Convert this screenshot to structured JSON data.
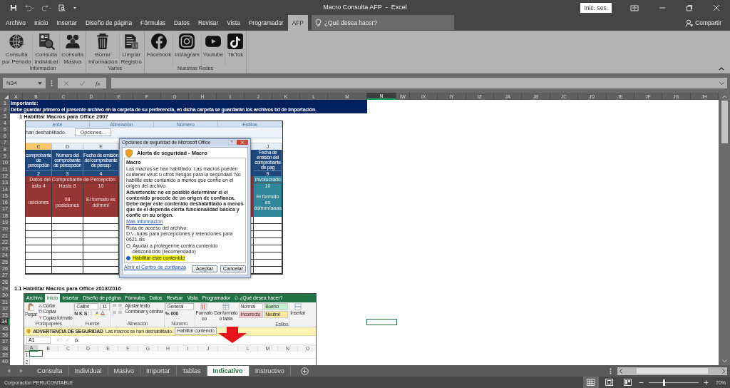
{
  "title_bar": {
    "title": "Macro Consulta AFP  -  Excel",
    "sign_in": "Inic. ses."
  },
  "menu_tabs": [
    {
      "label": "Archivo",
      "selected": false
    },
    {
      "label": "Inicio",
      "selected": false
    },
    {
      "label": "Insertar",
      "selected": false
    },
    {
      "label": "Diseño de página",
      "selected": false
    },
    {
      "label": "Fórmulas",
      "selected": false
    },
    {
      "label": "Datos",
      "selected": false
    },
    {
      "label": "Revisar",
      "selected": false
    },
    {
      "label": "Vista",
      "selected": false
    },
    {
      "label": "Programador",
      "selected": false
    },
    {
      "label": "AFP",
      "selected": true
    }
  ],
  "tell_me": {
    "placeholder": "¿Qué desea hacer?"
  },
  "share": "Compartir",
  "ribbon_groups": [
    {
      "label": "Informacion",
      "buttons": [
        {
          "kind": "globe",
          "lines": [
            "Consulta",
            "por Periodo"
          ]
        },
        {
          "kind": "search_doc",
          "lines": [
            "Consulta",
            "Individual"
          ]
        },
        {
          "kind": "people",
          "lines": [
            "Consulta",
            "Masiva"
          ]
        }
      ]
    },
    {
      "label": "Varios",
      "buttons": [
        {
          "kind": "trash",
          "lines": [
            "Borrar",
            "Información"
          ]
        },
        {
          "kind": "document",
          "lines": [
            "Limpiar",
            "Registro"
          ]
        }
      ]
    },
    {
      "label": "Nuestras Redes",
      "buttons": [
        {
          "kind": "facebook",
          "lines": [
            "Facebook"
          ]
        },
        {
          "kind": "instagram",
          "lines": [
            "Instagram"
          ]
        },
        {
          "kind": "youtube",
          "lines": [
            "Youtube"
          ]
        },
        {
          "kind": "tiktok",
          "lines": [
            "TikTok"
          ]
        }
      ]
    }
  ],
  "name_box": "N34",
  "fx": "fx",
  "columns": [
    {
      "label": "A",
      "selected": false
    },
    {
      "label": "B",
      "selected": false
    },
    {
      "label": "C",
      "selected": false
    },
    {
      "label": "D",
      "selected": false
    },
    {
      "label": "E",
      "selected": false
    },
    {
      "label": "F",
      "selected": false
    },
    {
      "label": "G",
      "selected": false
    },
    {
      "label": "H",
      "selected": false
    },
    {
      "label": "I",
      "selected": false
    },
    {
      "label": "J",
      "selected": false
    },
    {
      "label": "K",
      "selected": false
    },
    {
      "label": "L",
      "selected": false
    },
    {
      "label": "M",
      "selected": false
    },
    {
      "label": "N",
      "selected": true
    },
    {
      "label": "IW",
      "selected": false
    },
    {
      "label": "IX",
      "selected": false
    },
    {
      "label": "IY",
      "selected": false
    },
    {
      "label": "IZ",
      "selected": false
    },
    {
      "label": "JA",
      "selected": false
    },
    {
      "label": "JB",
      "selected": false
    },
    {
      "label": "JC",
      "selected": false
    },
    {
      "label": "JD",
      "selected": false
    },
    {
      "label": "JE",
      "selected": false
    },
    {
      "label": "JF",
      "selected": false
    },
    {
      "label": "JG",
      "selected": false
    },
    {
      "label": "JH",
      "selected": false
    }
  ],
  "rows": [
    {
      "label": "1",
      "selected": false
    },
    {
      "label": "2",
      "selected": false
    },
    {
      "label": "3",
      "selected": false
    },
    {
      "label": "4",
      "selected": false
    },
    {
      "label": "5",
      "selected": false
    },
    {
      "label": "6",
      "selected": false
    },
    {
      "label": "7",
      "selected": false
    },
    {
      "label": "8",
      "selected": false
    },
    {
      "label": "9",
      "selected": false
    },
    {
      "label": "10",
      "selected": false
    },
    {
      "label": "11",
      "selected": false
    },
    {
      "label": "12",
      "selected": false
    },
    {
      "label": "13",
      "selected": false
    },
    {
      "label": "14",
      "selected": false
    },
    {
      "label": "15",
      "selected": false
    },
    {
      "label": "16",
      "selected": false
    },
    {
      "label": "17",
      "selected": false
    },
    {
      "label": "18",
      "selected": false
    },
    {
      "label": "19",
      "selected": false
    },
    {
      "label": "20",
      "selected": false
    },
    {
      "label": "21",
      "selected": false
    },
    {
      "label": "22",
      "selected": false
    },
    {
      "label": "23",
      "selected": false
    },
    {
      "label": "24",
      "selected": false
    },
    {
      "label": "25",
      "selected": false
    },
    {
      "label": "26",
      "selected": false
    },
    {
      "label": "27",
      "selected": false
    },
    {
      "label": "28",
      "selected": false
    },
    {
      "label": "29",
      "selected": false
    },
    {
      "label": "30",
      "selected": false
    },
    {
      "label": "31",
      "selected": false
    },
    {
      "label": "32",
      "selected": false
    },
    {
      "label": "33",
      "selected": false
    },
    {
      "label": "34",
      "selected": true
    },
    {
      "label": "35",
      "selected": false
    },
    {
      "label": "36",
      "selected": false
    },
    {
      "label": "37",
      "selected": false
    },
    {
      "label": "38",
      "selected": false
    },
    {
      "label": "39",
      "selected": false
    },
    {
      "label": "40",
      "selected": false
    }
  ],
  "banner": {
    "heading": "Importante:",
    "text": "Debe guardar primero el presente archivo en la carpeta de su preferencia, en dicha carpeta se guardarán los archivos txt de importación."
  },
  "section_headings": [
    "1 Habilitar Macros  para Office 2007",
    "1.1 Habilitar Macros  para Office 2013/2016"
  ],
  "picture_2007": {
    "ribbon_groups": [
      "ente",
      "Alineación",
      "Número",
      "Estilos"
    ],
    "message": "han deshabilitado.",
    "options_button": "Opciones...",
    "left_columns": [
      {
        "label": "C",
        "selected": true,
        "header": "comprobante de percepción",
        "number": "2",
        "limit": "asta 4",
        "note": "osiciones"
      },
      {
        "label": "D",
        "selected": false,
        "header": "Número del comprobante de percepción",
        "number": "3",
        "limit": "Hasta 8",
        "note": "08 posiciones"
      },
      {
        "label": "E",
        "selected": false,
        "header": "Fecha de emisión del comprobante de percep",
        "number": "4",
        "limit": "10",
        "note": "El formato es dd/mm/"
      }
    ],
    "band": "Datos del Comprobante de Percepción",
    "right_column": {
      "label": "J",
      "header": "Fecha de emisión del comprobante de pag",
      "number": "9",
      "band": "involucrado",
      "limit": "10",
      "note": "El formato es dd/mm/aaaa"
    },
    "dialog": {
      "title": "Opciones de seguridad de Microsoft Office",
      "heading": "Alerta de seguridad - Macro",
      "section": "Macro",
      "info": "Las macros se han habilitado. Las macros pueden contener virus u otros riesgos para la seguridad. No habilite este contenido a menos que confíe en el origen del archivo.",
      "warning": "Advertencia: no es posible determinar si el contenido procede de un origen de confianza. Debe dejar este contenido deshabilitado a menos que de el dependa cierta funcionalidad básica y confíe en su origen.",
      "more_link": "Más información",
      "path_label": "Ruta de acceso del archivo:",
      "path": "D:\\...turas para percepciones y retenciones para 0621.xls",
      "options": [
        {
          "label": "Ayudar a protegerme contra contenido desconocido (recomendado)",
          "selected": false
        },
        {
          "label": "Habilitar este contenido",
          "selected": true
        }
      ],
      "trust_link": "Abrir el Centro de confianza",
      "buttons": [
        "Aceptar",
        "Cancelar"
      ]
    }
  },
  "picture_2013": {
    "tabs": [
      {
        "label": "Archivo",
        "selected": false
      },
      {
        "label": "Inicio",
        "selected": true
      },
      {
        "label": "Insertar",
        "selected": false
      },
      {
        "label": "Diseño de página",
        "selected": false
      },
      {
        "label": "Fórmulas",
        "selected": false
      },
      {
        "label": "Datos",
        "selected": false
      },
      {
        "label": "Revisar",
        "selected": false
      },
      {
        "label": "Vista",
        "selected": false
      },
      {
        "label": "Programador",
        "selected": false
      }
    ],
    "tell_me": "¿Qué desea hacer?",
    "paste": "Pegar",
    "clipboard_items": [
      "Cortar",
      "Copiar",
      "Copiar formato"
    ],
    "font": "Calibri",
    "font_size": "11",
    "font_styles": [
      "N",
      "K",
      "S"
    ],
    "wrap": "Ajustar texto",
    "merge": "Combinar y centrar",
    "number_format": "General",
    "number_symbols": [
      "%",
      "000"
    ],
    "format_buttons": [
      {
        "lines": [
          "Formato",
          "co"
        ]
      },
      {
        "lines": [
          "Dar formato",
          "o tabla"
        ]
      }
    ],
    "cell_styles": [
      {
        "label": "Normal",
        "color": "#ffffff"
      },
      {
        "label": "Bueno",
        "color": "#c6efce"
      },
      {
        "label": "Incorrecto",
        "color": "#ffc7ce"
      },
      {
        "label": "Neutral",
        "color": "#ffeb9c"
      }
    ],
    "insert": "Insertar",
    "group_labels": [
      "Portapapeles",
      "Fuente",
      "Alineación",
      "Número",
      "Estilos"
    ],
    "security": {
      "title": "ADVERTENCIA DE SEGURIDAD",
      "message": "Las macros se han deshabilitado.",
      "button": "Habilitar contenido"
    },
    "name_box": "A1",
    "fx": "fx",
    "columns": [
      {
        "label": "A",
        "selected": true
      },
      {
        "label": "B",
        "selected": false
      },
      {
        "label": "C",
        "selected": false
      },
      {
        "label": "D",
        "selected": false
      },
      {
        "label": "E",
        "selected": false
      },
      {
        "label": "F",
        "selected": false
      },
      {
        "label": "G",
        "selected": false
      },
      {
        "label": "H",
        "selected": false
      },
      {
        "label": "I",
        "selected": false
      },
      {
        "label": "J",
        "selected": false
      },
      {
        "selected": false
      },
      {
        "label": "L",
        "selected": false
      },
      {
        "label": "M",
        "selected": false
      },
      {
        "label": "N",
        "selected": false
      },
      {
        "label": "O",
        "selected": false
      }
    ],
    "rows": [
      "1",
      "2"
    ]
  },
  "sheet_tabs": [
    {
      "label": "Consulta",
      "selected": false
    },
    {
      "label": "Individual",
      "selected": false
    },
    {
      "label": "Masivo",
      "selected": false
    },
    {
      "label": "Importar",
      "selected": false
    },
    {
      "label": "Tablas",
      "selected": false
    },
    {
      "label": "Indicativo",
      "selected": true
    },
    {
      "label": "Instructivo",
      "selected": false
    }
  ],
  "status_bar": {
    "text": "Corporación PERUCONTABLE",
    "views": [
      {
        "kind": "normal",
        "selected": true
      },
      {
        "kind": "page_layout",
        "selected": false
      },
      {
        "kind": "page_break",
        "selected": false
      }
    ],
    "zoom": {
      "level": 0.3,
      "reading": "70%"
    }
  }
}
